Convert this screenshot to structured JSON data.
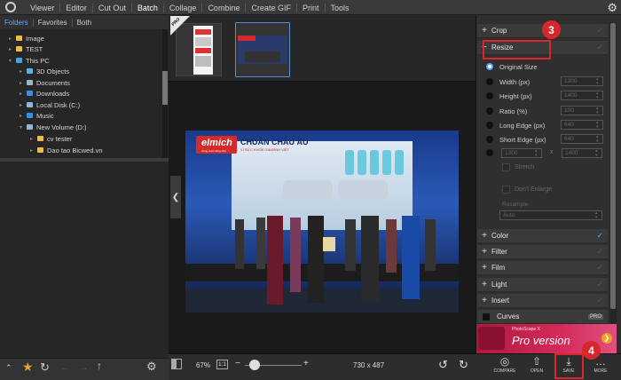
{
  "menu": {
    "items": [
      "Viewer",
      "Editor",
      "Cut Out",
      "Batch",
      "Collage",
      "Combine",
      "Create GIF",
      "Print",
      "Tools"
    ],
    "active": "Batch"
  },
  "folder_tabs": [
    "Folders",
    "Favorites",
    "Both"
  ],
  "tree": [
    {
      "label": "Image",
      "indent": 1,
      "icon": "folder-icon"
    },
    {
      "label": "TEST",
      "indent": 1,
      "icon": "folder-icon"
    },
    {
      "label": "This PC",
      "indent": 0,
      "icon": "pc-icon"
    },
    {
      "label": "3D Objects",
      "indent": 1,
      "icon": "3d-objects-icon"
    },
    {
      "label": "Documents",
      "indent": 1,
      "icon": "documents-icon"
    },
    {
      "label": "Downloads",
      "indent": 1,
      "icon": "downloads-icon"
    },
    {
      "label": "Local Disk (C:)",
      "indent": 1,
      "icon": "drive-icon"
    },
    {
      "label": "Music",
      "indent": 1,
      "icon": "music-icon"
    },
    {
      "label": "New Volume (D:)",
      "indent": 1,
      "icon": "drive-icon"
    },
    {
      "label": "cv tester",
      "indent": 2,
      "icon": "folder-icon"
    },
    {
      "label": "Dao tao Bicwed.vn",
      "indent": 2,
      "icon": "folder-icon"
    }
  ],
  "thumbnails": {
    "pro_label": "PRO"
  },
  "image": {
    "brand": "elmich",
    "brand_sub": "Cùng cuộc sống Việt",
    "headline": "CHUẨN CHÂU ÂU",
    "subline": "VÌ SỨC KHỎE GIA ĐÌNH VIỆT"
  },
  "status": {
    "zoom": "67%",
    "fit": "1:1",
    "dimensions": "730 x 487"
  },
  "panel": {
    "crop": "Crop",
    "resize": "Resize",
    "options": [
      "Original Size",
      "Width (px)",
      "Height (px)",
      "Ratio (%)",
      "Long Edge (px)",
      "Short Edge (px)"
    ],
    "fields": [
      "1300",
      "1400",
      "100",
      "640",
      "640"
    ],
    "wh_fields": [
      "1300",
      "1400"
    ],
    "times": "x",
    "stretch": "Stretch",
    "dont_enlarge": "Don't Enlarge",
    "resample_label": "Resample",
    "resample_value": "Auto",
    "sections": [
      "Color",
      "Filter",
      "Film",
      "Light",
      "Insert",
      "Curves"
    ],
    "curves_badge": "PRO"
  },
  "banner": {
    "brand": "PhotoScape X",
    "title": "Pro version"
  },
  "right_buttons": [
    "COMPARE",
    "OPEN",
    "SAVE",
    "MORE"
  ],
  "badges": [
    "3",
    "4"
  ],
  "colors": {
    "accent": "#5aa7ff",
    "highlight": "#e0242b",
    "banner": "#c21e47"
  }
}
